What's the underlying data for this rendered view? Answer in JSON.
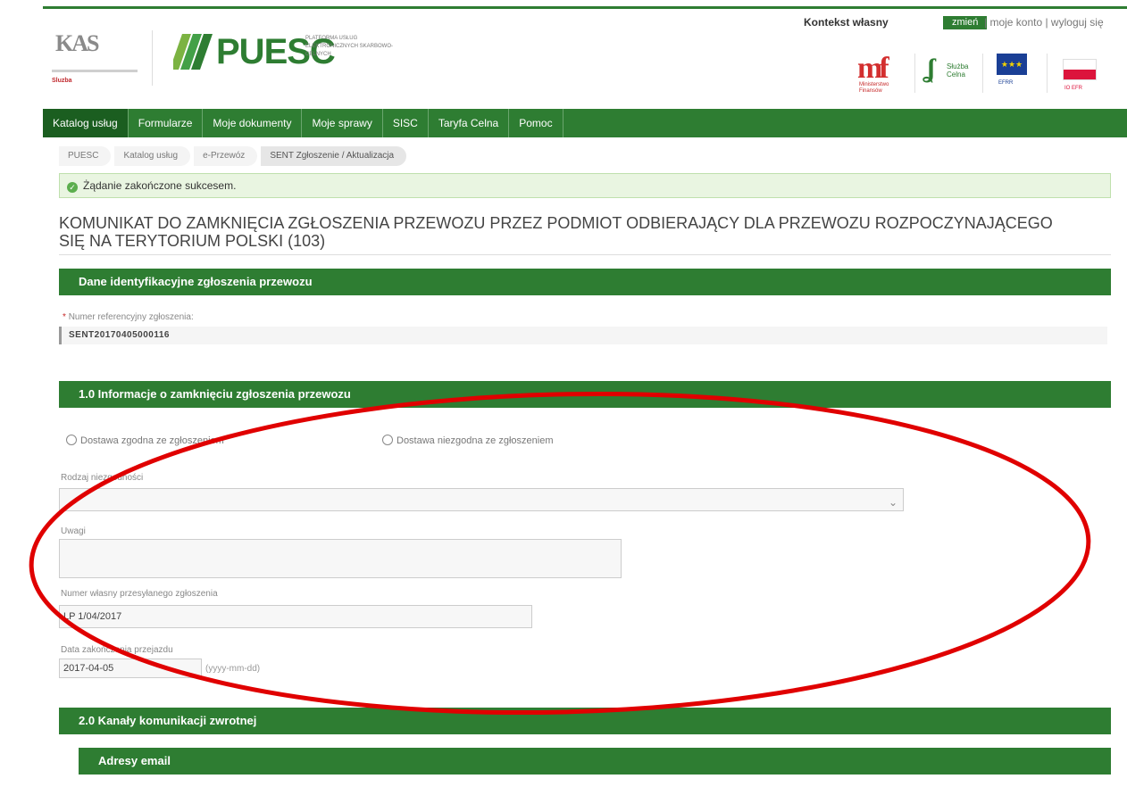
{
  "header": {
    "context_label": "Kontekst własny",
    "change_button": "zmień",
    "account_links": "| moje konto | wyloguj się",
    "kas_logo_text": "KAS",
    "kas_logo_caption": "Sluzba",
    "puesc_logo_text": "PUESC",
    "puesc_desc": "PLATFORMA USŁUG ELEKTRONICZNYCH SKARBOWO-CELNYCH",
    "partners": {
      "mf": "Ministerstwo Finansów",
      "sc_title": "Służba",
      "sc_sub": "Celna",
      "eu": "EFRR",
      "pl": "IO EFR"
    }
  },
  "nav": {
    "items": [
      "Katalog usług",
      "Formularze",
      "Moje dokumenty",
      "Moje sprawy",
      "SISC",
      "Taryfa Celna",
      "Pomoc"
    ],
    "active": "Katalog usług"
  },
  "breadcrumb": [
    "PUESC",
    "Katalog usług",
    "e-Przewóz",
    "SENT Zgłoszenie / Aktualizacja"
  ],
  "alert": {
    "icon": "check-circle-icon",
    "text": "Żądanie zakończone sukcesem."
  },
  "page_title": "KOMUNIKAT DO ZAMKNIĘCIA ZGŁOSZENIA PRZEWOZU PRZEZ PODMIOT ODBIERAJĄCY DLA PRZEWOZU ROZPOCZYNAJĄCEGO SIĘ NA TERYTORIUM POLSKI (103)",
  "sections": {
    "identification": {
      "title": "Dane identyfikacyjne zgłoszenia przewozu",
      "ref_label": "Numer referencyjny zgłoszenia:",
      "ref_required": "*",
      "ref_value": "SENT20170405000116"
    },
    "closing": {
      "title": "1.0 Informacje o zamknięciu zgłoszenia przewozu",
      "radio_ok": "Dostawa zgodna ze zgłoszeniem",
      "radio_bad": "Dostawa niezgodna ze zgłoszeniem",
      "type_label": "Rodzaj niezgodności",
      "type_value": "",
      "notes_label": "Uwagi",
      "notes_value": "",
      "own_number_label": "Numer własny przesyłanego zgłoszenia",
      "own_number_value": "LP 1/04/2017",
      "date_label": "Data zakończenia przejazdu",
      "date_value": "2017-04-05",
      "date_hint": "(yyyy-mm-dd)"
    },
    "channels": {
      "title": "2.0 Kanały komunikacji zwrotnej",
      "emails_title": "Adresy email"
    }
  },
  "colors": {
    "brand_green": "#2e7d32",
    "annotation_red": "#e00000",
    "alert_bg": "#e9f5e1"
  }
}
